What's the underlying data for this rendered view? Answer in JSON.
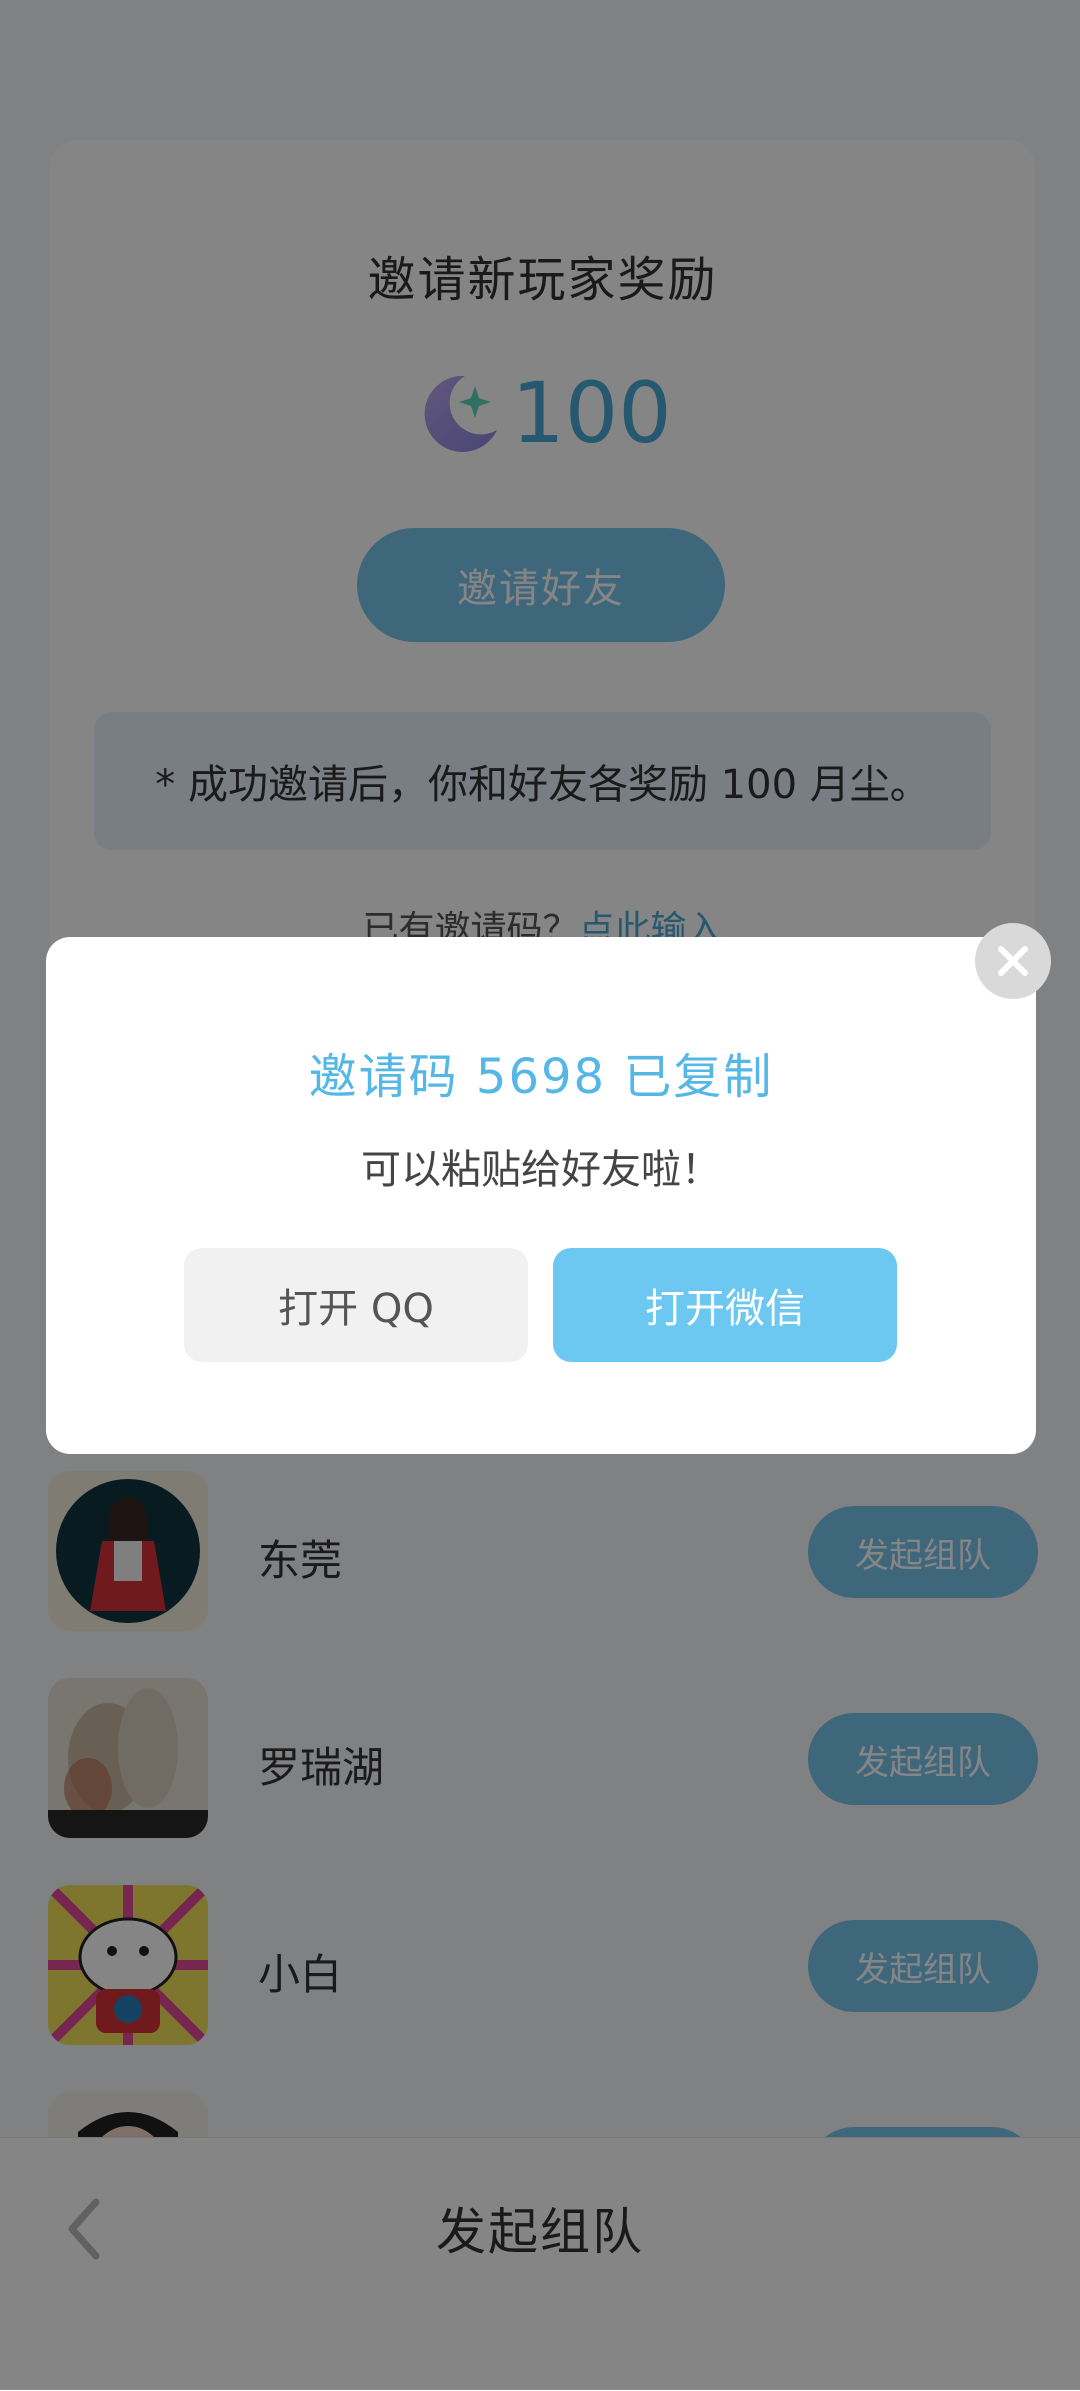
{
  "card": {
    "title": "邀请新玩家奖励",
    "reward_value": "100",
    "invite_button": "邀请好友",
    "hint": "* 成功邀请后，你和好友各奖励 100 月尘。",
    "has_code_text": "已有邀请码？",
    "enter_code_link": "点此输入"
  },
  "list": {
    "button_label": "发起组队",
    "items": [
      {
        "name": "东莞",
        "avatar": "avatar-anime-girl-icon"
      },
      {
        "name": "罗瑞湖",
        "avatar": "avatar-blurred-photo-icon"
      },
      {
        "name": "小白",
        "avatar": "avatar-cartoon-dog-icon"
      },
      {
        "name": "",
        "avatar": "avatar-face-illustration-icon"
      }
    ]
  },
  "bottom_bar": {
    "title": "发起组队"
  },
  "modal": {
    "title": "邀请码 5698 已复制",
    "subtitle": "可以粘贴给好友啦！",
    "qq_button": "打开 QQ",
    "wechat_button": "打开微信"
  },
  "colors": {
    "accent": "#6cc8f1",
    "title_blue": "#54b7e6",
    "overlay": "rgba(0,0,0,0.48)"
  }
}
